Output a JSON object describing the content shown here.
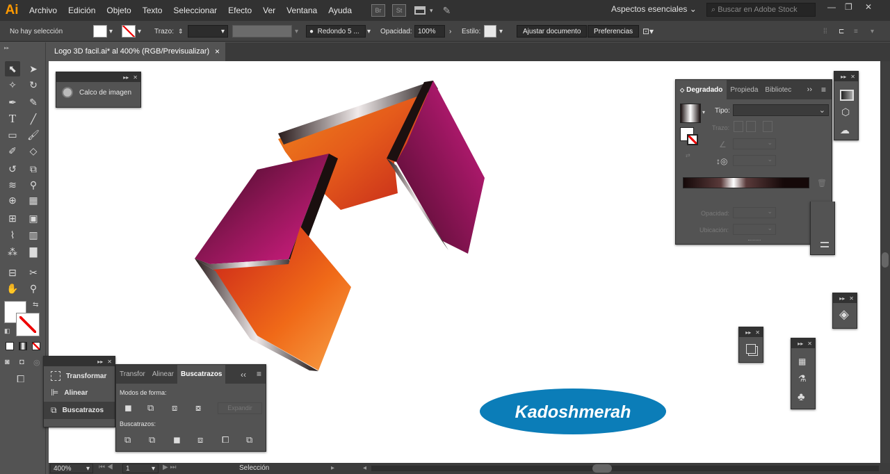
{
  "app": {
    "logo": "Ai"
  },
  "menu": [
    "Archivo",
    "Edición",
    "Objeto",
    "Texto",
    "Seleccionar",
    "Efecto",
    "Ver",
    "Ventana",
    "Ayuda"
  ],
  "menubar_icons": {
    "bridge": "Br",
    "stock": "St"
  },
  "workspace": {
    "label": "Aspectos esenciales"
  },
  "search": {
    "placeholder": "Buscar en Adobe Stock"
  },
  "control_bar": {
    "selection_status": "No hay selección",
    "stroke_label": "Trazo:",
    "brush_label": "Redondo 5 ...",
    "opacity_label": "Opacidad:",
    "opacity_value": "100%",
    "style_label": "Estilo:",
    "adjust_button": "Ajustar documento",
    "prefs_button": "Preferencias"
  },
  "document_tab": {
    "title": "Logo 3D facil.ai* al 400% (RGB/Previsualizar)",
    "close": "×"
  },
  "image_trace_panel": {
    "label": "Calco de imagen"
  },
  "gradient_panel": {
    "tabs": [
      "Degradado",
      "Propieda",
      "Bibliotec"
    ],
    "type_label": "Tipo:",
    "stroke_label": "Trazo:",
    "opacity_label": "Opacidad:",
    "location_label": "Ubicación:"
  },
  "mini_panel": {
    "items": [
      "Transformar",
      "Alinear",
      "Buscatrazos"
    ]
  },
  "pathfinder_panel": {
    "tabs": [
      "Transfor",
      "Alinear",
      "Buscatrazos"
    ],
    "shape_modes_label": "Modos de forma:",
    "expand_button": "Expandir",
    "pathfinders_label": "Buscatrazos:"
  },
  "canvas": {
    "badge_text": "Kadoshmerah"
  },
  "status_bar": {
    "zoom": "400%",
    "artboard": "1",
    "tool": "Selección"
  },
  "colors": {
    "accent_orange": "#ff9a00",
    "magenta": "#c2147d",
    "orange": "#e8561c",
    "badge_blue": "#0b7db8"
  }
}
